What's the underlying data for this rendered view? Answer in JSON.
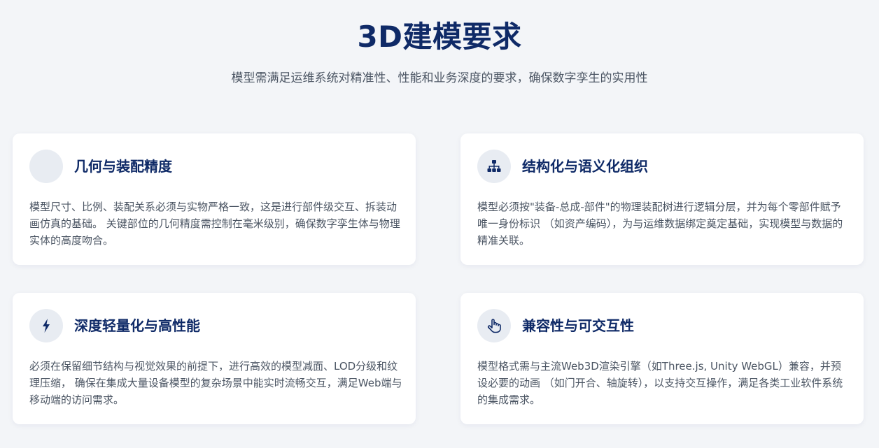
{
  "header": {
    "title": "3D建模要求",
    "subtitle": "模型需满足运维系统对精准性、性能和业务深度的要求，确保数字孪生的实用性"
  },
  "cards": [
    {
      "icon": "blank-circle-icon",
      "title": "几何与装配精度",
      "description": "模型尺寸、比例、装配关系必须与实物严格一致，这是进行部件级交互、拆装动画仿真的基础。 关键部位的几何精度需控制在毫米级别，确保数字孪生体与物理实体的高度吻合。"
    },
    {
      "icon": "hierarchy-icon",
      "title": "结构化与语义化组织",
      "description": "模型必须按\"装备-总成-部件\"的物理装配树进行逻辑分层，并为每个零部件赋予唯一身份标识 （如资产编码），为与运维数据绑定奠定基础，实现模型与数据的精准关联。"
    },
    {
      "icon": "lightning-bolt-icon",
      "title": "深度轻量化与高性能",
      "description": "必须在保留细节结构与视觉效果的前提下，进行高效的模型减面、LOD分级和纹理压缩， 确保在集成大量设备模型的复杂场景中能实时流畅交互，满足Web端与移动端的访问需求。"
    },
    {
      "icon": "pointing-hand-icon",
      "title": "兼容性与可交互性",
      "description": "模型格式需与主流Web3D渲染引擎（如Three.js, Unity WebGL）兼容，并预设必要的动画 （如门开合、轴旋转），以支持交互操作，满足各类工业软件系统的集成需求。"
    }
  ],
  "colors": {
    "background": "#f3f5f8",
    "card": "#ffffff",
    "title": "#0f2a67",
    "text": "#4b5563",
    "icon_circle": "#e8ecf2"
  }
}
